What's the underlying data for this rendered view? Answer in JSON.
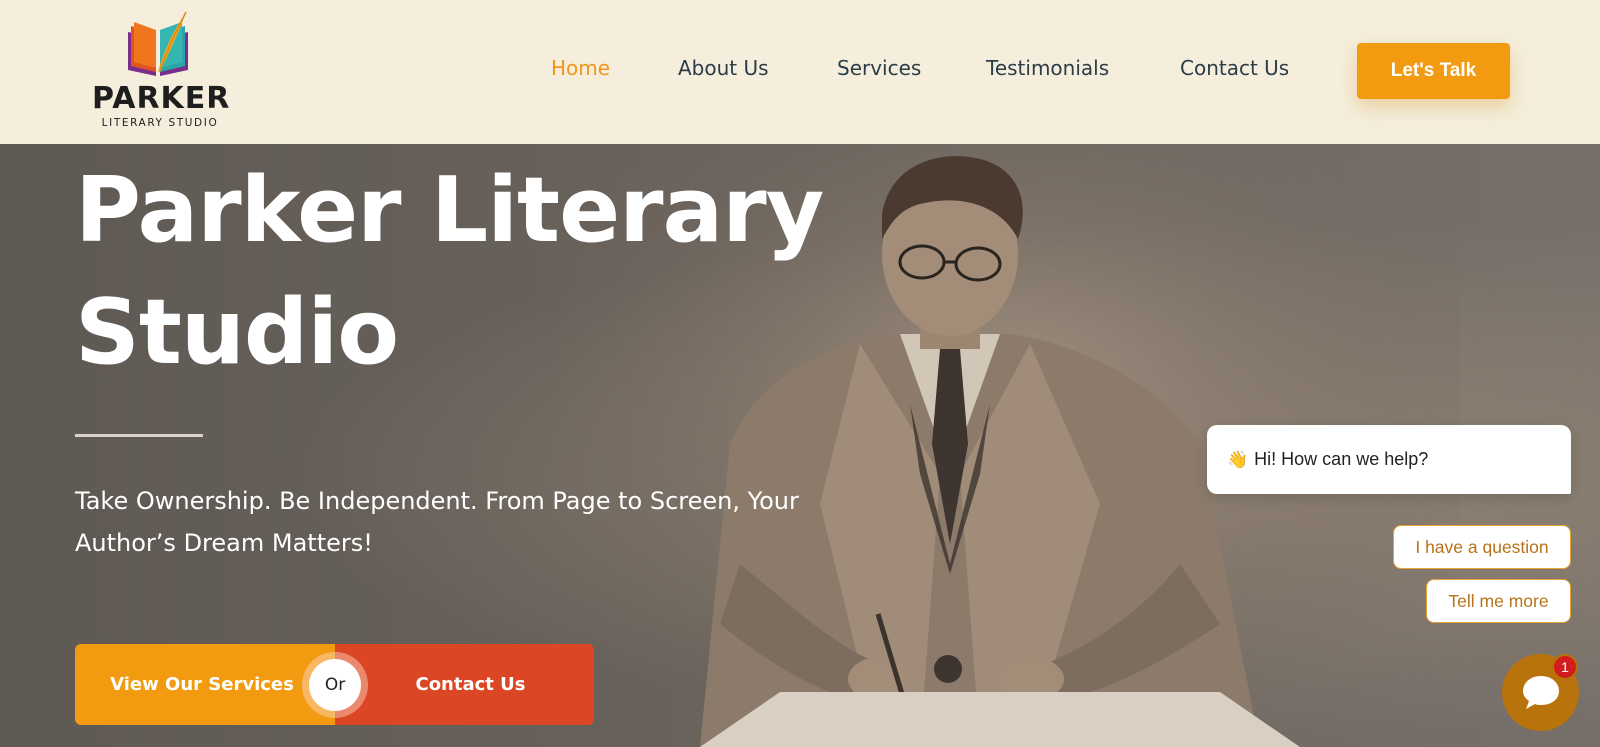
{
  "brand": {
    "name": "PARKER",
    "subtitle": "LITERARY STUDIO",
    "colors": {
      "orange": "#f29b11",
      "red": "#db4624",
      "teal": "#2aa6a6",
      "purple": "#7b2d8c",
      "cream": "#f5eedc",
      "navText": "#2b3d48"
    }
  },
  "nav": {
    "items": [
      {
        "label": "Home",
        "active": true
      },
      {
        "label": "About Us",
        "active": false
      },
      {
        "label": "Services",
        "active": false
      },
      {
        "label": "Testimonials",
        "active": false
      },
      {
        "label": "Contact Us",
        "active": false
      }
    ],
    "cta_label": "Let's Talk"
  },
  "hero": {
    "title": "Parker Literary Studio",
    "tagline": "Take Ownership. Be Independent. From Page to Screen, Your Author’s Dream Matters!",
    "image_desc_icon": "man-writing-photo"
  },
  "cta": {
    "left_label": "View Our Services",
    "or_label": "Or",
    "right_label": "Contact Us"
  },
  "chat": {
    "greeting_emoji": "👋",
    "greeting": "Hi! How can we help?",
    "quick_replies": [
      "I have a question",
      "Tell me more"
    ],
    "unread_count": "1",
    "launcher_icon": "chat-bubble-icon"
  }
}
